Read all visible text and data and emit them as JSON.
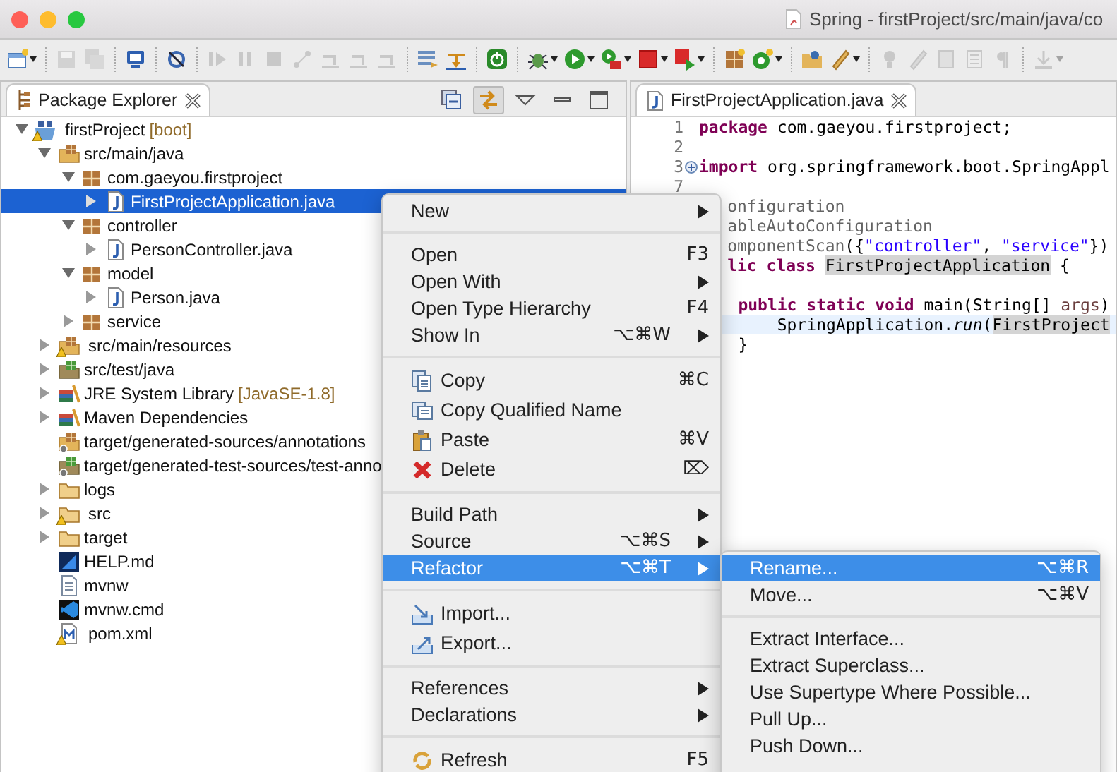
{
  "window": {
    "title": "Spring - firstProject/src/main/java/co"
  },
  "toolbar": [
    {
      "kind": "new",
      "disabled": false,
      "dropdown": true
    },
    {
      "kind": "sep"
    },
    {
      "kind": "save",
      "disabled": true,
      "dropdown": false
    },
    {
      "kind": "save-all",
      "disabled": true,
      "dropdown": false
    },
    {
      "kind": "sep"
    },
    {
      "kind": "monitor",
      "disabled": false,
      "dropdown": false
    },
    {
      "kind": "sep"
    },
    {
      "kind": "skip",
      "disabled": false,
      "dropdown": false
    },
    {
      "kind": "sep"
    },
    {
      "kind": "resume",
      "disabled": true,
      "dropdown": false
    },
    {
      "kind": "suspend",
      "disabled": true,
      "dropdown": false
    },
    {
      "kind": "terminate",
      "disabled": true,
      "dropdown": false
    },
    {
      "kind": "disconnect",
      "disabled": true,
      "dropdown": false
    },
    {
      "kind": "step-into",
      "disabled": true,
      "dropdown": false
    },
    {
      "kind": "step-over",
      "disabled": true,
      "dropdown": false
    },
    {
      "kind": "step-return",
      "disabled": true,
      "dropdown": false
    },
    {
      "kind": "sep"
    },
    {
      "kind": "drop",
      "disabled": false,
      "dropdown": false
    },
    {
      "kind": "step-filter",
      "disabled": false,
      "dropdown": false
    },
    {
      "kind": "sep"
    },
    {
      "kind": "spring",
      "disabled": false,
      "dropdown": false
    },
    {
      "kind": "sep"
    },
    {
      "kind": "debug",
      "disabled": false,
      "dropdown": true
    },
    {
      "kind": "run",
      "disabled": false,
      "dropdown": true
    },
    {
      "kind": "run-ext",
      "disabled": false,
      "dropdown": true
    },
    {
      "kind": "stop",
      "disabled": false,
      "dropdown": true
    },
    {
      "kind": "launch",
      "disabled": false,
      "dropdown": true
    },
    {
      "kind": "sep"
    },
    {
      "kind": "package",
      "disabled": false,
      "dropdown": false
    },
    {
      "kind": "new-class",
      "disabled": false,
      "dropdown": true
    },
    {
      "kind": "sep"
    },
    {
      "kind": "open-type",
      "disabled": false,
      "dropdown": false
    },
    {
      "kind": "pen",
      "disabled": false,
      "dropdown": true
    },
    {
      "kind": "sep"
    },
    {
      "kind": "lamp",
      "disabled": true,
      "dropdown": false
    },
    {
      "kind": "pen",
      "disabled": true,
      "dropdown": false
    },
    {
      "kind": "doc",
      "disabled": true,
      "dropdown": false
    },
    {
      "kind": "block",
      "disabled": true,
      "dropdown": false
    },
    {
      "kind": "pilcrow",
      "disabled": true,
      "dropdown": false
    },
    {
      "kind": "sep"
    },
    {
      "kind": "down",
      "disabled": true,
      "dropdown": true
    }
  ],
  "explorer": {
    "title": "Package Explorer",
    "view_actions": [
      {
        "kind": "collapse",
        "on": false
      },
      {
        "kind": "link",
        "on": true
      },
      {
        "kind": "menu",
        "on": false
      },
      {
        "kind": "minimize",
        "on": false
      },
      {
        "kind": "maximize",
        "on": false
      }
    ],
    "tree": [
      {
        "label": "firstProject",
        "tag": "[boot]",
        "kind": "project",
        "warning": true,
        "expanded": true,
        "selected": false,
        "children": [
          {
            "label": "src/main/java",
            "kind": "source-folder",
            "expanded": true,
            "selected": false,
            "children": [
              {
                "label": "com.gaeyou.firstproject",
                "kind": "package",
                "expanded": true,
                "selected": false,
                "children": [
                  {
                    "label": "FirstProjectApplication.java",
                    "kind": "java",
                    "expanded": false,
                    "selected": true
                  }
                ]
              },
              {
                "label": "controller",
                "kind": "package",
                "expanded": true,
                "selected": false,
                "children": [
                  {
                    "label": "PersonController.java",
                    "kind": "java",
                    "expanded": false,
                    "selected": false
                  }
                ]
              },
              {
                "label": "model",
                "kind": "package",
                "expanded": true,
                "selected": false,
                "children": [
                  {
                    "label": "Person.java",
                    "kind": "java",
                    "expanded": false,
                    "selected": false
                  }
                ]
              },
              {
                "label": "service",
                "kind": "package",
                "expanded": false,
                "selected": false
              }
            ]
          },
          {
            "label": "src/main/resources",
            "kind": "source-folder",
            "warning": true,
            "expanded": false,
            "selected": false
          },
          {
            "label": "src/test/java",
            "kind": "test-folder",
            "expanded": false,
            "selected": false
          },
          {
            "label": "JRE System Library",
            "tag": "[JavaSE-1.8]",
            "kind": "library",
            "expanded": false,
            "selected": false
          },
          {
            "label": "Maven Dependencies",
            "kind": "library",
            "expanded": false,
            "selected": false
          },
          {
            "label": "target/generated-sources/annotations",
            "kind": "source-folder-off",
            "selected": false
          },
          {
            "label": "target/generated-test-sources/test-anno",
            "kind": "test-folder-off",
            "selected": false
          },
          {
            "label": "logs",
            "kind": "folder",
            "expanded": false,
            "selected": false
          },
          {
            "label": "src",
            "kind": "folder",
            "warning": true,
            "expanded": false,
            "selected": false
          },
          {
            "label": "target",
            "kind": "folder",
            "expanded": false,
            "selected": false
          },
          {
            "label": "HELP.md",
            "kind": "markdown",
            "selected": false
          },
          {
            "label": "mvnw",
            "kind": "text",
            "selected": false
          },
          {
            "label": "mvnw.cmd",
            "kind": "vscode",
            "selected": false
          },
          {
            "label": "pom.xml",
            "kind": "maven",
            "warning": true,
            "selected": false
          }
        ]
      }
    ]
  },
  "editor": {
    "tab": "FirstProjectApplication.java",
    "lines": [
      {
        "number": "1",
        "folded": false,
        "current": false,
        "kind": "full",
        "tokens": [
          {
            "kind": "keyword",
            "text": "package"
          },
          {
            "kind": "plain",
            "text": " com.gaeyou.firstproject;"
          }
        ]
      },
      {
        "number": "2",
        "folded": false,
        "current": false
      },
      {
        "number": "3",
        "folded": true,
        "current": false,
        "kind": "full",
        "tokens": [
          {
            "kind": "keyword",
            "text": "import"
          },
          {
            "kind": "plain",
            "text": " org.springframework.boot.SpringAppl"
          }
        ]
      },
      {
        "number": "7",
        "folded": false,
        "current": false
      },
      {
        "current": false,
        "kind": "cut",
        "tokens": [
          {
            "kind": "annotation",
            "text": "onfiguration"
          }
        ]
      },
      {
        "current": false,
        "kind": "cut",
        "tokens": [
          {
            "kind": "annotation",
            "text": "ableAutoConfiguration"
          }
        ]
      },
      {
        "current": false,
        "kind": "cut",
        "tokens": [
          {
            "kind": "annotation",
            "text": "omponentScan"
          },
          {
            "kind": "plain",
            "text": "({"
          },
          {
            "kind": "string",
            "text": "\"controller\""
          },
          {
            "kind": "plain",
            "text": ", "
          },
          {
            "kind": "string",
            "text": "\"service\""
          },
          {
            "kind": "plain",
            "text": "})"
          }
        ]
      },
      {
        "current": false,
        "kind": "cut",
        "tokens": [
          {
            "kind": "keyword",
            "text": "lic class "
          },
          {
            "kind": "highlight",
            "text": "FirstProjectApplication"
          },
          {
            "kind": "plain",
            "text": " {"
          }
        ]
      },
      {
        "current": false
      },
      {
        "current": false,
        "kind": "indent1",
        "tokens": [
          {
            "kind": "keyword",
            "text": "public static void"
          },
          {
            "kind": "plain",
            "text": " main(String[] "
          },
          {
            "kind": "param",
            "text": "args"
          },
          {
            "kind": "plain",
            "text": ")"
          }
        ]
      },
      {
        "current": true,
        "kind": "indent2",
        "tokens": [
          {
            "kind": "plain",
            "text": "SpringApplication."
          },
          {
            "kind": "italic",
            "text": "run"
          },
          {
            "kind": "plain",
            "text": "("
          },
          {
            "kind": "highlight",
            "text": "FirstProject"
          }
        ]
      },
      {
        "current": false,
        "kind": "indent1",
        "tokens": [
          {
            "kind": "plain",
            "text": "}"
          }
        ]
      }
    ]
  },
  "context_menu": {
    "sections": [
      [
        {
          "label": "New",
          "submenu": true,
          "selected": false
        }
      ],
      [
        {
          "label": "Open",
          "shortcut": "F3",
          "submenu": false,
          "selected": false
        },
        {
          "label": "Open With",
          "submenu": true,
          "selected": false
        },
        {
          "label": "Open Type Hierarchy",
          "shortcut": "F4",
          "submenu": false,
          "selected": false
        },
        {
          "label": "Show In",
          "shortcut": "⌥⌘W",
          "submenu": true,
          "selected": false
        }
      ],
      [
        {
          "label": "Copy",
          "kind": "copy",
          "shortcut": "⌘C",
          "submenu": false,
          "selected": false
        },
        {
          "label": "Copy Qualified Name",
          "kind": "copy-qualified",
          "submenu": false,
          "selected": false
        },
        {
          "label": "Paste",
          "kind": "paste",
          "shortcut": "⌘V",
          "submenu": false,
          "selected": false
        },
        {
          "label": "Delete",
          "kind": "delete",
          "shortcut": "⌦",
          "submenu": false,
          "selected": false
        }
      ],
      [
        {
          "label": "Build Path",
          "submenu": true,
          "selected": false
        },
        {
          "label": "Source",
          "shortcut": "⌥⌘S",
          "submenu": true,
          "selected": false
        },
        {
          "label": "Refactor",
          "shortcut": "⌥⌘T",
          "submenu": true,
          "selected": true
        }
      ],
      [
        {
          "label": "Import...",
          "kind": "import",
          "submenu": false,
          "selected": false
        },
        {
          "label": "Export...",
          "kind": "export",
          "submenu": false,
          "selected": false
        }
      ],
      [
        {
          "label": "References",
          "submenu": true,
          "selected": false
        },
        {
          "label": "Declarations",
          "submenu": true,
          "selected": false
        }
      ],
      [
        {
          "label": "Refresh",
          "kind": "refresh",
          "shortcut": "F5",
          "submenu": false,
          "selected": false
        }
      ]
    ]
  },
  "refactor_menu": {
    "sections": [
      [
        {
          "label": "Rename...",
          "shortcut": "⌥⌘R",
          "selected": true
        },
        {
          "label": "Move...",
          "shortcut": "⌥⌘V",
          "selected": false
        }
      ],
      [
        {
          "label": "Extract Interface...",
          "selected": false
        },
        {
          "label": "Extract Superclass...",
          "selected": false
        },
        {
          "label": "Use Supertype Where Possible...",
          "selected": false
        },
        {
          "label": "Pull Up...",
          "selected": false
        },
        {
          "label": "Push Down...",
          "selected": false
        }
      ]
    ]
  }
}
